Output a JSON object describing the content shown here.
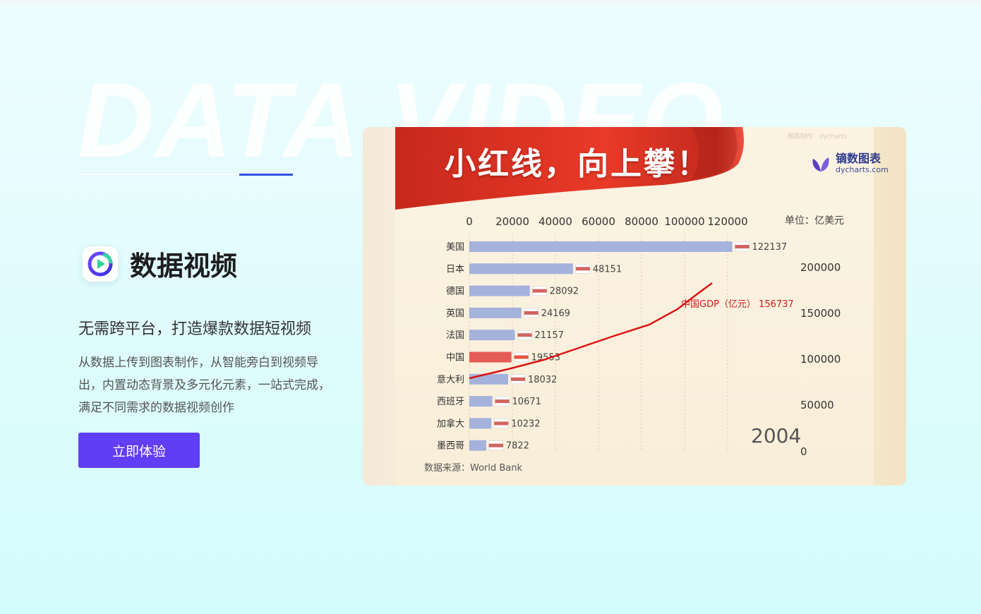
{
  "hero": {
    "background_text": "DATA VIDEO"
  },
  "product": {
    "name": "数据视频",
    "subtitle": "无需跨平台，打造爆款数据短视频",
    "description": "从数据上传到图表制作，从智能旁白到视频导出，内置动态背景及多元化元素，一站式完成，满足不同需求的数据视频创作",
    "cta_label": "立即体验"
  },
  "preview": {
    "headline": "小红线，向上攀！",
    "watermark": "图表制作：dycharts",
    "brand_cn": "镝数图表",
    "brand_en": "dycharts.com",
    "source": "数据来源：World Bank",
    "year": "2004"
  },
  "colors": {
    "cta": "#5f3ef5",
    "accent_blue": "#2f54eb",
    "bar": "#a4b2dc",
    "bar_highlight": "#e45c55",
    "line": "#dc1414"
  },
  "chart_data": {
    "type": "bar",
    "orientation": "horizontal",
    "title": "小红线，向上攀！",
    "unit_label": "单位：亿美元",
    "xlim": [
      0,
      120000
    ],
    "x_ticks": [
      0,
      20000,
      40000,
      60000,
      80000,
      100000,
      120000
    ],
    "categories": [
      "美国",
      "日本",
      "德国",
      "英国",
      "法国",
      "中国",
      "意大利",
      "西班牙",
      "加拿大",
      "墨西哥"
    ],
    "values": [
      122137,
      48151,
      28092,
      24169,
      21157,
      19553,
      18032,
      10671,
      10232,
      7822
    ],
    "highlight": "中国",
    "secondary_series": {
      "type": "line",
      "name": "中国GDP（亿元）",
      "end_label": "156737",
      "end_value": 156737,
      "y_ticks": [
        0,
        50000,
        100000,
        150000,
        200000
      ]
    },
    "source": "数据来源：World Bank",
    "year_label": "2004"
  }
}
